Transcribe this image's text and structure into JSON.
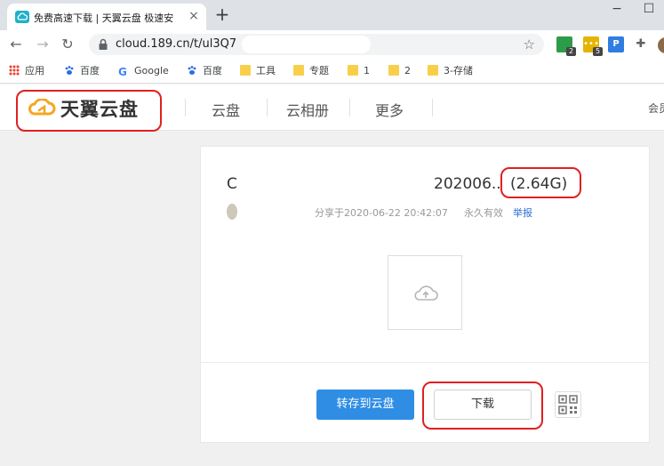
{
  "browser": {
    "tab_title": "免费高速下载 | 天翼云盘 极速安",
    "tab_close": "×",
    "new_tab": "+",
    "window_controls": [
      "−",
      "☐"
    ],
    "url": "cloud.189.cn/t/ul3Q7",
    "nav": {
      "back": "←",
      "forward": "→",
      "reload": "↻"
    },
    "star": "☆",
    "extensions": [
      {
        "label": "",
        "badge": "2",
        "color": "#2d9c4a"
      },
      {
        "label": "•••",
        "badge": "5",
        "color": "#e6b400"
      },
      {
        "label": "P",
        "badge": "",
        "color": "#2f7de1"
      }
    ],
    "puzzle": "✚",
    "bookmarks": [
      {
        "label": "应用",
        "icon": "apps-icon"
      },
      {
        "label": "百度",
        "icon": "baidu-paw-icon"
      },
      {
        "label": "Google",
        "icon": "google-g-icon"
      },
      {
        "label": "百度",
        "icon": "baidu-paw-icon"
      },
      {
        "label": "工具",
        "icon": "folder-icon"
      },
      {
        "label": "专题",
        "icon": "folder-icon"
      },
      {
        "label": "1",
        "icon": "folder-icon"
      },
      {
        "label": "2",
        "icon": "folder-icon"
      },
      {
        "label": "3-存储",
        "icon": "folder-icon"
      }
    ]
  },
  "site": {
    "logo_text": "天翼云盘",
    "nav": [
      "云盘",
      "云相册",
      "更多"
    ],
    "right_text": "会员"
  },
  "share": {
    "file_prefix": "C",
    "file_name": "202006..",
    "file_size": "(2.64G)",
    "share_time": "分享于2020-06-22 20:42:07",
    "validity": "永久有效",
    "report": "举报",
    "save_button": "转存到云盘",
    "download_button": "下载"
  },
  "colors": {
    "accent": "#2f8de4",
    "highlight": "#e02020",
    "logo_orange": "#f5a623"
  }
}
